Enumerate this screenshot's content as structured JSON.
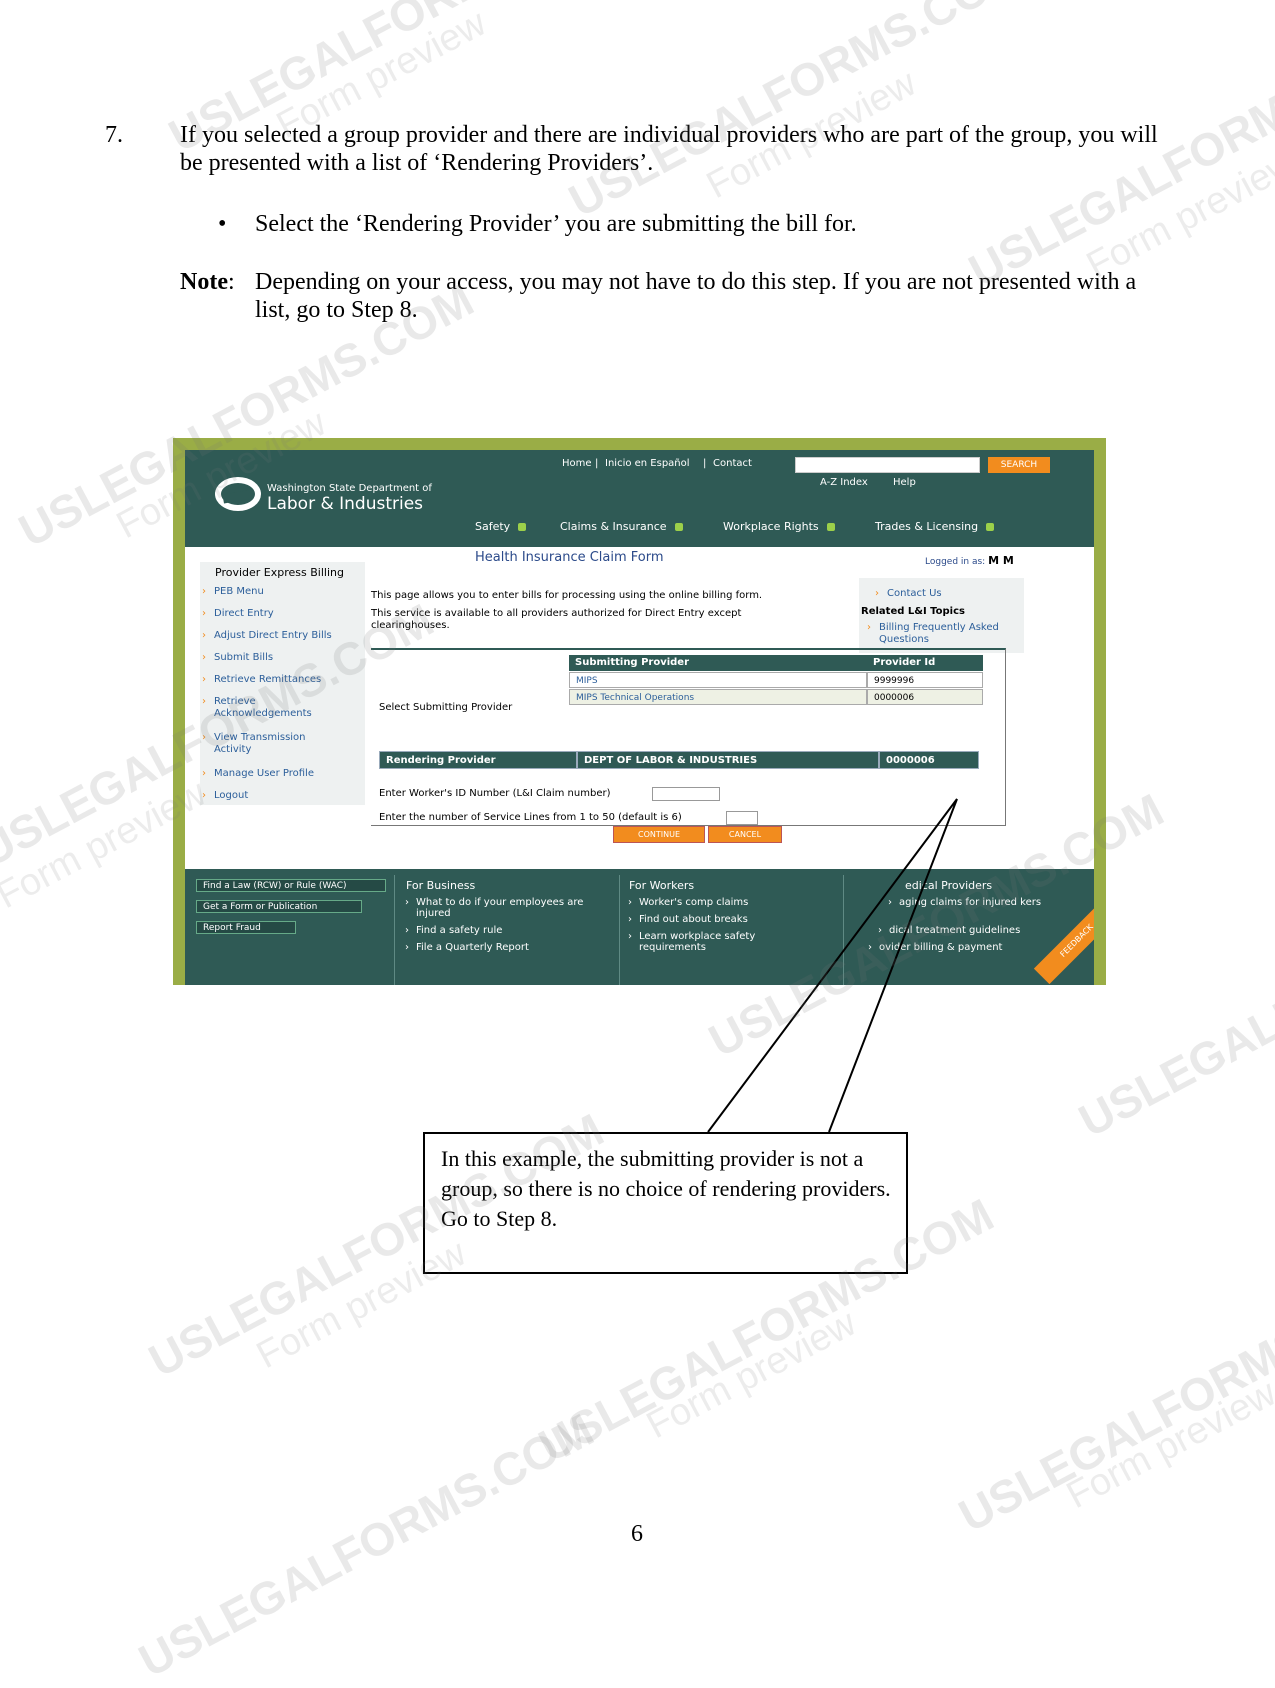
{
  "step": {
    "number": "7.",
    "text": "If you selected a group provider and there are individual providers who are part of the group, you will be presented with a list of ‘Rendering Providers’.",
    "bullet": "Select the ‘Rendering Provider’ you are submitting the bill for."
  },
  "note": {
    "label": "Note",
    "text": "Depending on your access, you may not have to do this step. If you are not presented with a list, go to Step 8."
  },
  "screenshot": {
    "header": {
      "top_links": [
        "Home",
        "Inicio en Español",
        "Contact"
      ],
      "search_button": "SEARCH",
      "sub_links": [
        "A-Z Index",
        "Help"
      ],
      "dept_line": "Washington State Department of",
      "org_name": "Labor & Industries",
      "nav": [
        "Safety",
        "Claims & Insurance",
        "Workplace Rights",
        "Trades & Licensing"
      ]
    },
    "sidebar": {
      "title": "Provider Express Billing",
      "items": [
        "PEB Menu",
        "Direct Entry",
        "Adjust Direct Entry Bills",
        "Submit Bills",
        "Retrieve Remittances",
        "Retrieve Acknowledgements",
        "View Transmission Activity",
        "Manage User Profile",
        "Logout"
      ]
    },
    "page_title": "Health Insurance Claim Form",
    "logged_in_label": "Logged in as:",
    "logged_in_user": "M M",
    "intro_1": "This page allows you to enter bills for processing using the online billing form.",
    "intro_2": "This service is available to all providers authorized for Direct Entry except clearinghouses.",
    "related": {
      "contact": "Contact Us",
      "heading": "Related L&I Topics",
      "link": "Billing Frequently Asked Questions"
    },
    "select_label": "Select Submitting Provider",
    "provider_table": {
      "headers": [
        "Submitting Provider",
        "Provider Id"
      ],
      "rows": [
        {
          "name": "MIPS",
          "id": "9999996"
        },
        {
          "name": "MIPS Technical Operations",
          "id": "0000006"
        }
      ]
    },
    "rendering_row": [
      "Rendering Provider",
      "DEPT OF LABOR & INDUSTRIES",
      "0000006"
    ],
    "worker_label": "Enter Worker's ID Number (L&I Claim number)",
    "lines_label": "Enter the number of Service Lines from 1 to 50 (default is 6)",
    "buttons": {
      "continue": "CONTINUE",
      "cancel": "CANCEL"
    },
    "footer": {
      "quick_links": [
        "Find a Law (RCW) or Rule (WAC)",
        "Get a Form or Publication",
        "Report Fraud"
      ],
      "business_heading": "For Business",
      "business_items": [
        "What to do if your employees are injured",
        "Find a safety rule",
        "File a Quarterly Report"
      ],
      "workers_heading": "For Workers",
      "workers_items": [
        "Worker's comp claims",
        "Find out about breaks",
        "Learn workplace safety requirements"
      ],
      "providers_heading": "edical Providers",
      "providers_items": [
        "aging claims for injured kers",
        "dical treatment guidelines",
        "ovider billing & payment"
      ],
      "feedback": "FEEDBACK"
    }
  },
  "callout": "In this example, the submitting provider is not a group, so there is no choice of rendering providers. Go to Step 8.",
  "page_number": "6",
  "watermark": {
    "brand": "USLEGALFORMS.COM",
    "sub": "Form preview"
  }
}
